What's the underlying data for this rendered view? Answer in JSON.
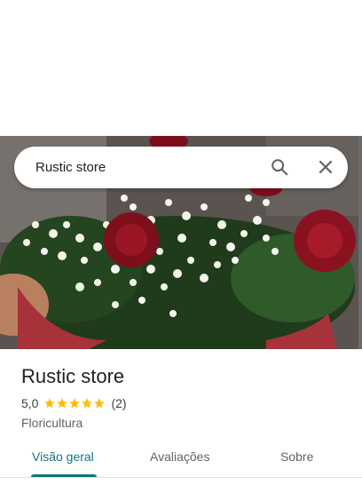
{
  "search": {
    "query": "Rustic store"
  },
  "place": {
    "name": "Rustic store",
    "rating": "5,0",
    "rating_value": 5,
    "rating_max": 5,
    "review_count": "(2)",
    "category": "Floricultura"
  },
  "tabs": [
    {
      "label": "Visão geral",
      "active": true
    },
    {
      "label": "Avaliações",
      "active": false
    },
    {
      "label": "Sobre",
      "active": false
    }
  ],
  "colors": {
    "accent": "#12737a",
    "star": "#fbbc04"
  },
  "icons": {
    "search": "search-icon",
    "close": "close-icon"
  }
}
